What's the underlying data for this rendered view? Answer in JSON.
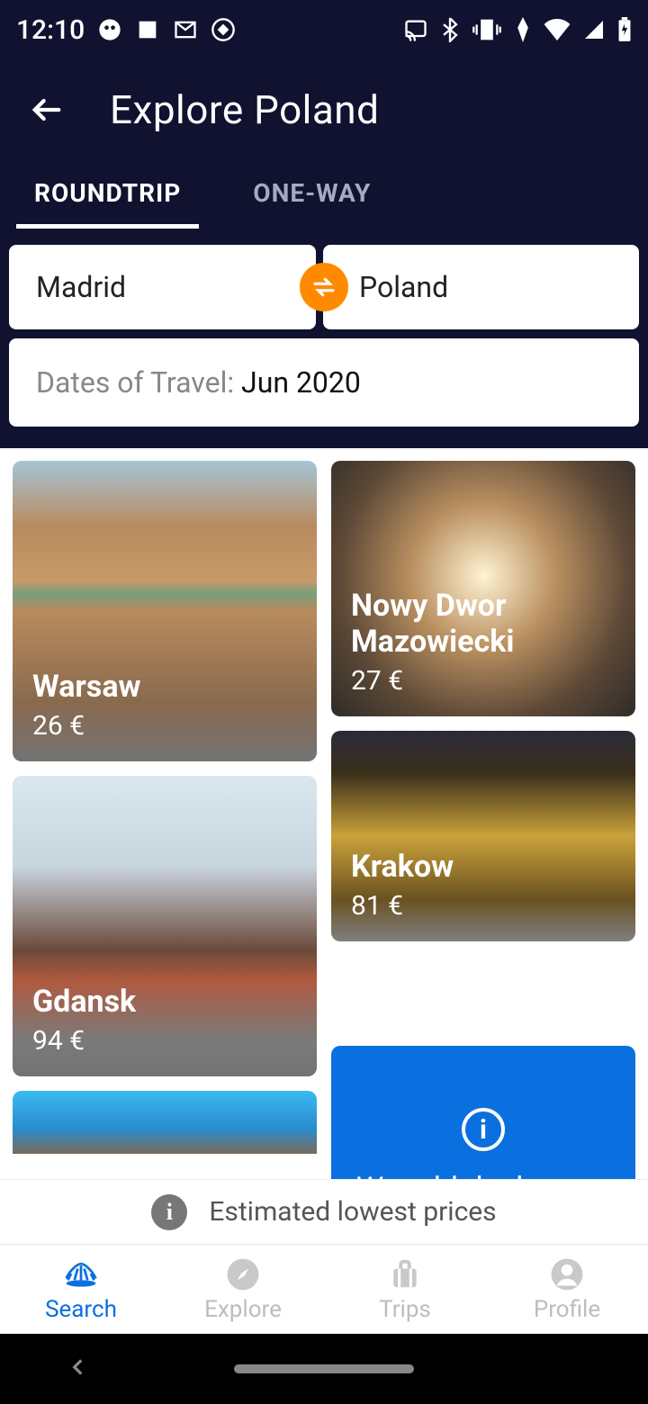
{
  "statusbar": {
    "time": "12:10"
  },
  "header": {
    "title": "Explore Poland"
  },
  "tabs": {
    "roundtrip": "ROUNDTRIP",
    "oneway": "ONE-WAY"
  },
  "search": {
    "origin": "Madrid",
    "destination": "Poland",
    "datesLabel": "Dates of Travel: ",
    "datesValue": "Jun 2020"
  },
  "cards": {
    "warsaw": {
      "name": "Warsaw",
      "price": "26 €"
    },
    "nowy": {
      "name": "Nowy Dwor Mazowiecki",
      "price": "27 €"
    },
    "gdansk": {
      "name": "Gdansk",
      "price": "94 €"
    },
    "krakow": {
      "name": "Krakow",
      "price": "81 €"
    }
  },
  "deals": {
    "text": "We add deals as we find them"
  },
  "estimated": "Estimated lowest prices",
  "nav": {
    "search": "Search",
    "explore": "Explore",
    "trips": "Trips",
    "profile": "Profile"
  }
}
